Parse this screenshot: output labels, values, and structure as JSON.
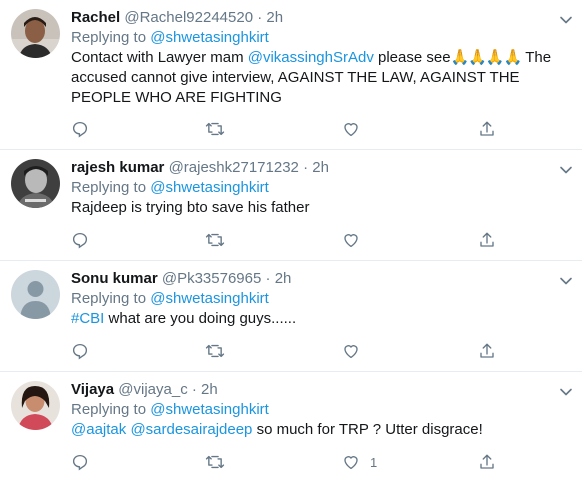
{
  "tweets": [
    {
      "name": "Rachel",
      "handle": "@Rachel92244520",
      "dot": "·",
      "time": "2h",
      "replying_prefix": "Replying to",
      "replying_to": "@shwetasinghkirt",
      "text_parts": {
        "a": "Contact with Lawyer mam ",
        "mention": "@vikassinghSrAdv",
        "b": "  please see",
        "emoji": "🙏🙏🙏🙏",
        "c": " The accused cannot give interview, AGAINST THE LAW, AGAINST THE PEOPLE WHO ARE FIGHTING"
      },
      "like_count": ""
    },
    {
      "name": "rajesh kumar",
      "handle": "@rajeshk27171232",
      "dot": "·",
      "time": "2h",
      "replying_prefix": "Replying to",
      "replying_to": "@shwetasinghkirt",
      "text": "Rajdeep is trying bto save his father",
      "like_count": ""
    },
    {
      "name": "Sonu kumar",
      "handle": "@Pk33576965",
      "dot": "·",
      "time": "2h",
      "replying_prefix": "Replying to",
      "replying_to": "@shwetasinghkirt",
      "hashtag": "#CBI",
      "text": " what are you doing guys......",
      "like_count": ""
    },
    {
      "name": "Vijaya",
      "handle": "@vijaya_c",
      "dot": "·",
      "time": "2h",
      "replying_prefix": "Replying to",
      "replying_to": "@shwetasinghkirt",
      "mention1": "@aajtak",
      "mention2": "@sardesairajdeep",
      "text": " so much for TRP ? Utter disgrace!",
      "like_count": "1"
    }
  ],
  "icons": [
    "chevron-down-icon",
    "reply-icon",
    "retweet-icon",
    "like-icon",
    "share-icon"
  ],
  "colors": {
    "link": "#1b95e0",
    "muted": "#657786",
    "text": "#14171a",
    "divider": "#e6ecf0"
  }
}
